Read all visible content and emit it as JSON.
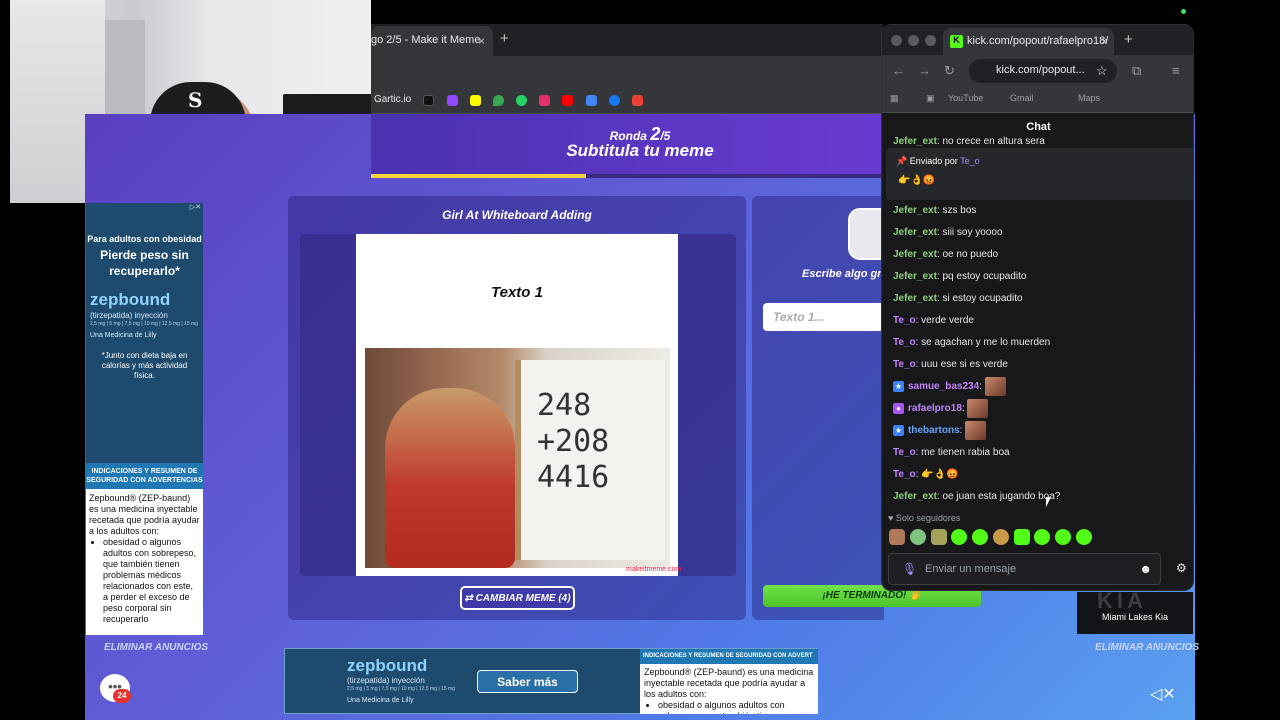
{
  "browser": {
    "tab_title": "go 2/5 - Make it Meme",
    "new_tab": "+",
    "close": "×",
    "bookmark_first": "Gartic.io"
  },
  "game": {
    "round_label": "Ronda",
    "round_current": "2",
    "round_total": "/5",
    "round_progress": 0.42,
    "subtitle": "Subtitula tu meme",
    "meme_name": "Girl At Whiteboard Adding",
    "meme_text_1": "Texto 1",
    "meme_watermark": "makeitmeme.com",
    "meme_math": "248\n+208\n4416",
    "change_meme_button": "CAMBIAR MEME (4)",
    "write_prompt": "Escribe algo gra",
    "input_placeholder": "Texto 1...",
    "done_button": "¡HE TERMINADO!",
    "remove_ads": "ELIMINAR ANUNCIOS",
    "chat_badge_count": "24"
  },
  "ad_side": {
    "headline_small": "Para adultos con obesidad",
    "headline": "Pierde peso sin recuperarlo*",
    "brand": "zepbound",
    "product": "(tirzepatida) inyección",
    "doses": "2,5 mg | 5 mg | 7,5 mg | 10 mg | 12,5 mg | 15 mg",
    "maker": "Una Medicina de Lilly",
    "note": "*Junto con dieta baja en calorías y más actividad física.",
    "warning_header": "INDICACIONES Y RESUMEN DE SEGURIDAD CON ADVERTENCIAS",
    "body_intro": "Zepbound® (ZEP-baund) es una medicina inyectable recetada que podría ayudar a los adultos con:",
    "body_bullet": "obesidad o algunos adultos con sobrepeso, que también tienen problemas médicos relacionados con este, a perder el exceso de peso corporal sin recuperarlo"
  },
  "ad_bottom": {
    "brand": "zepbound",
    "product": "(tirzepatida) inyección",
    "doses": "2,5 mg | 5 mg | 7,5 mg | 10 mg | 12,5 mg | 15 mg",
    "maker": "Una Medicina de Lilly",
    "button": "Saber más",
    "warning_header": "INDICACIONES Y RESUMEN DE SEGURIDAD CON ADVERT",
    "body_intro": "Zepbound® (ZEP-baund) es una medicina inyectable recetada que podría ayudar a los adultos con:",
    "body_bullet": "obesidad o algunos adultos con sobrepeso, que también tienen"
  },
  "sponsor": {
    "name": "Miami Lakes Kia"
  },
  "popout": {
    "tab_title": "kick.com/popout/rafaelpro18/",
    "url": "kick.com/popout...",
    "bookmarks": [
      "YouTube",
      "Gmail",
      "Maps"
    ],
    "chat_title": "Chat",
    "cut_message_user": "Jefer_ext",
    "cut_message_text": "no crece en altura sera",
    "pinned_label": "Enviado por",
    "pinned_user": "Te_o",
    "pinned_emotes": "👉👌😡",
    "messages": [
      {
        "user": "Jefer_ext",
        "text": "szs bos"
      },
      {
        "user": "Jefer_ext",
        "text": "siii soy yoooo"
      },
      {
        "user": "Jefer_ext",
        "text": "oe no puedo"
      },
      {
        "user": "Jefer_ext",
        "text": "pq estoy ocupadito"
      },
      {
        "user": "Jefer_ext",
        "text": "si estoy ocupadito"
      },
      {
        "user": "Te_o",
        "text": "verde verde"
      },
      {
        "user": "Te_o",
        "text": "se agachan y me lo muerden"
      },
      {
        "user": "Te_o",
        "text": "uuu ese si es verde"
      },
      {
        "user": "samue_bas234",
        "text": ""
      },
      {
        "user": "rafaelpro18",
        "text": ""
      },
      {
        "user": "thebartons",
        "text": ""
      },
      {
        "user": "Te_o",
        "text": "me tienen rabia boa"
      },
      {
        "user": "Te_o",
        "text": "👉👌😡"
      },
      {
        "user": "Jefer_ext",
        "text": "oe juan esta jugando boa?"
      }
    ],
    "followers_only": "Solo seguidores",
    "send_placeholder": "Enviar un mensaje"
  },
  "colors": {
    "kick_green": "#53fc18",
    "game_purple": "#5a3fc0",
    "done_green": "#4cc42a",
    "progress_yellow": "#f6d43a"
  }
}
